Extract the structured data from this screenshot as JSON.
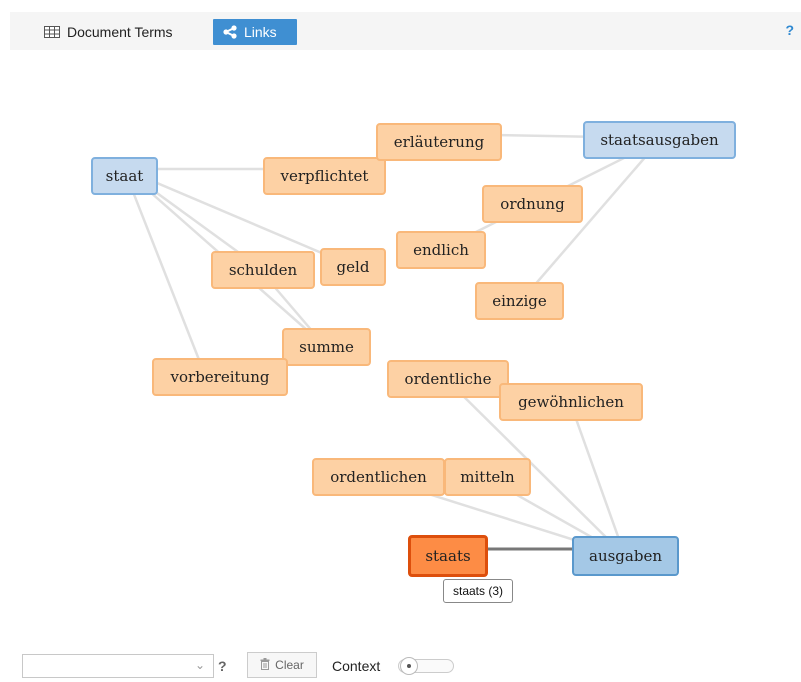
{
  "tabs": {
    "terms_label": "Document Terms",
    "links_label": "Links",
    "help": "?"
  },
  "graph": {
    "nodes": {
      "staat": "staat",
      "verpflichtet": "verpflichtet",
      "erlaeuterung": "erläuterung",
      "staatsausgaben": "staatsausgaben",
      "ordnung": "ordnung",
      "endlich": "endlich",
      "geld": "geld",
      "schulden": "schulden",
      "einzige": "einzige",
      "summe": "summe",
      "vorbereitung": "vorbereitung",
      "ordentliche": "ordentliche",
      "gewoehnlichen": "gewöhnlichen",
      "ordentlichen": "ordentlichen",
      "mitteln": "mitteln",
      "staats": "staats",
      "ausgaben": "ausgaben"
    },
    "tooltip": "staats (3)",
    "colors": {
      "term_node": "#fdd1a4",
      "keyword_node": "#c6daef",
      "selected_node": "#fd8c45",
      "link": "#e0e0e0",
      "active_link": "#777777"
    }
  },
  "footer": {
    "help": "?",
    "clear_label": "Clear",
    "context_label": "Context",
    "context_value": 0
  }
}
